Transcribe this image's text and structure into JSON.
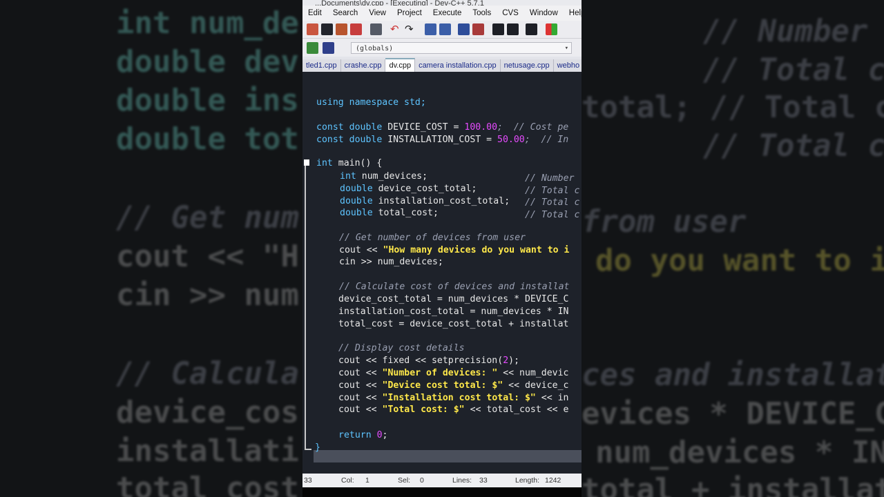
{
  "window": {
    "title": "...Documents\\dv.cpp - [Executing] - Dev-C++ 5.7.1"
  },
  "menu": [
    "Edit",
    "Search",
    "View",
    "Project",
    "Execute",
    "Tools",
    "CVS",
    "Window",
    "Help"
  ],
  "scope_selector": {
    "value": "(globals)"
  },
  "tabs": [
    "tled1.cpp",
    "crashe.cpp",
    "dv.cpp",
    "camera installation.cpp",
    "netusage.cpp",
    "webho"
  ],
  "active_tab": "dv.cpp",
  "code": {
    "line_using": "using namespace std;",
    "dc_kw": "const double",
    "dc_name": " DEVICE_COST = ",
    "dc_val": "100.00",
    "dc_cm": ";  // Cost pe",
    "ic_kw": "const double",
    "ic_name": " INSTALLATION_COST = ",
    "ic_val": "50.00",
    "ic_cm": ";  // In",
    "main_kw": "int",
    "main_rest": " main() {",
    "v1_kw": "int",
    "v1_rest": " num_devices;",
    "v1_cm": "// Number",
    "v2_kw": "double",
    "v2_rest": " device_cost_total;",
    "v2_cm": "// Total c",
    "v3_kw": "double",
    "v3_rest": " installation_cost_total;",
    "v3_cm": "// Total c",
    "v4_kw": "double",
    "v4_rest": " total_cost;",
    "v4_cm": "// Total c",
    "c_get": "// Get number of devices from user",
    "cout1_a": "cout << ",
    "cout1_s": "\"How many devices do you want to i",
    "cin1": "cin >> num_devices;",
    "c_calc": "// Calculate cost of devices and installat",
    "calc1": "device_cost_total = num_devices * DEVICE_C",
    "calc2": "installation_cost_total = num_devices * IN",
    "calc3": "total_cost = device_cost_total + installat",
    "c_disp": "// Display cost details",
    "fx_a": "cout << fixed << setprecision(",
    "fx_n": "2",
    "fx_b": ");",
    "d1_a": "cout << ",
    "d1_s": "\"Number of devices: \"",
    "d1_b": " << num_devic",
    "d2_a": "cout << ",
    "d2_s": "\"Device cost total: $\"",
    "d2_b": " << device_c",
    "d3_a": "cout << ",
    "d3_s": "\"Installation cost total: $\"",
    "d3_b": " << in",
    "d4_a": "cout << ",
    "d4_s": "\"Total cost: $\"",
    "d4_b": " << total_cost << e",
    "ret_kw": "return",
    "ret_sp": " ",
    "ret_n": "0",
    "ret_end": ";",
    "close": "}"
  },
  "status": {
    "line": "33",
    "col_label": "Col:",
    "col": "1",
    "sel_label": "Sel:",
    "sel": "0",
    "lines_label": "Lines:",
    "lines": "33",
    "length_label": "Length:",
    "length": "1242"
  },
  "background": {
    "left": [
      "int num_de",
      "double dev",
      "double ins",
      "double tot",
      "// Get num",
      "cout << \"H",
      "cin >> num",
      "// Calcula",
      "device_cos",
      "installati",
      "total_cost"
    ],
    "right": [
      "// Number",
      "// Total c",
      "total; // Total c",
      "// Total c",
      "from user",
      "do you want to i",
      "ces and installat",
      "evices * DEVICE_C",
      "num_devices * IN",
      "total + installat"
    ]
  },
  "colors": {
    "keyword": "#5ec4ff",
    "number": "#e64bff",
    "string": "#ffe84a",
    "comment": "#9aa0b2",
    "editor_bg": "#1e222a"
  }
}
